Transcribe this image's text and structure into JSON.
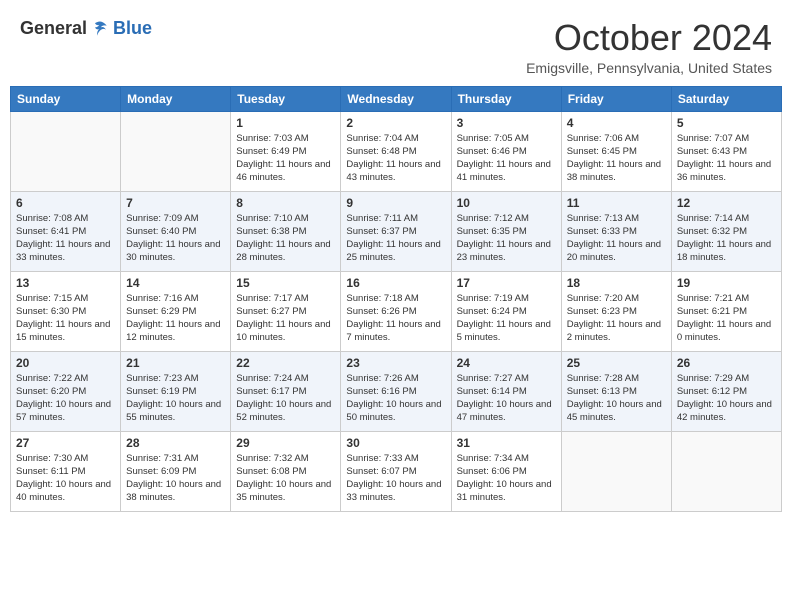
{
  "header": {
    "logo_general": "General",
    "logo_blue": "Blue",
    "month_title": "October 2024",
    "location": "Emigsville, Pennsylvania, United States"
  },
  "days_of_week": [
    "Sunday",
    "Monday",
    "Tuesday",
    "Wednesday",
    "Thursday",
    "Friday",
    "Saturday"
  ],
  "weeks": [
    [
      {
        "day": "",
        "sunrise": "",
        "sunset": "",
        "daylight": ""
      },
      {
        "day": "",
        "sunrise": "",
        "sunset": "",
        "daylight": ""
      },
      {
        "day": "1",
        "sunrise": "Sunrise: 7:03 AM",
        "sunset": "Sunset: 6:49 PM",
        "daylight": "Daylight: 11 hours and 46 minutes."
      },
      {
        "day": "2",
        "sunrise": "Sunrise: 7:04 AM",
        "sunset": "Sunset: 6:48 PM",
        "daylight": "Daylight: 11 hours and 43 minutes."
      },
      {
        "day": "3",
        "sunrise": "Sunrise: 7:05 AM",
        "sunset": "Sunset: 6:46 PM",
        "daylight": "Daylight: 11 hours and 41 minutes."
      },
      {
        "day": "4",
        "sunrise": "Sunrise: 7:06 AM",
        "sunset": "Sunset: 6:45 PM",
        "daylight": "Daylight: 11 hours and 38 minutes."
      },
      {
        "day": "5",
        "sunrise": "Sunrise: 7:07 AM",
        "sunset": "Sunset: 6:43 PM",
        "daylight": "Daylight: 11 hours and 36 minutes."
      }
    ],
    [
      {
        "day": "6",
        "sunrise": "Sunrise: 7:08 AM",
        "sunset": "Sunset: 6:41 PM",
        "daylight": "Daylight: 11 hours and 33 minutes."
      },
      {
        "day": "7",
        "sunrise": "Sunrise: 7:09 AM",
        "sunset": "Sunset: 6:40 PM",
        "daylight": "Daylight: 11 hours and 30 minutes."
      },
      {
        "day": "8",
        "sunrise": "Sunrise: 7:10 AM",
        "sunset": "Sunset: 6:38 PM",
        "daylight": "Daylight: 11 hours and 28 minutes."
      },
      {
        "day": "9",
        "sunrise": "Sunrise: 7:11 AM",
        "sunset": "Sunset: 6:37 PM",
        "daylight": "Daylight: 11 hours and 25 minutes."
      },
      {
        "day": "10",
        "sunrise": "Sunrise: 7:12 AM",
        "sunset": "Sunset: 6:35 PM",
        "daylight": "Daylight: 11 hours and 23 minutes."
      },
      {
        "day": "11",
        "sunrise": "Sunrise: 7:13 AM",
        "sunset": "Sunset: 6:33 PM",
        "daylight": "Daylight: 11 hours and 20 minutes."
      },
      {
        "day": "12",
        "sunrise": "Sunrise: 7:14 AM",
        "sunset": "Sunset: 6:32 PM",
        "daylight": "Daylight: 11 hours and 18 minutes."
      }
    ],
    [
      {
        "day": "13",
        "sunrise": "Sunrise: 7:15 AM",
        "sunset": "Sunset: 6:30 PM",
        "daylight": "Daylight: 11 hours and 15 minutes."
      },
      {
        "day": "14",
        "sunrise": "Sunrise: 7:16 AM",
        "sunset": "Sunset: 6:29 PM",
        "daylight": "Daylight: 11 hours and 12 minutes."
      },
      {
        "day": "15",
        "sunrise": "Sunrise: 7:17 AM",
        "sunset": "Sunset: 6:27 PM",
        "daylight": "Daylight: 11 hours and 10 minutes."
      },
      {
        "day": "16",
        "sunrise": "Sunrise: 7:18 AM",
        "sunset": "Sunset: 6:26 PM",
        "daylight": "Daylight: 11 hours and 7 minutes."
      },
      {
        "day": "17",
        "sunrise": "Sunrise: 7:19 AM",
        "sunset": "Sunset: 6:24 PM",
        "daylight": "Daylight: 11 hours and 5 minutes."
      },
      {
        "day": "18",
        "sunrise": "Sunrise: 7:20 AM",
        "sunset": "Sunset: 6:23 PM",
        "daylight": "Daylight: 11 hours and 2 minutes."
      },
      {
        "day": "19",
        "sunrise": "Sunrise: 7:21 AM",
        "sunset": "Sunset: 6:21 PM",
        "daylight": "Daylight: 11 hours and 0 minutes."
      }
    ],
    [
      {
        "day": "20",
        "sunrise": "Sunrise: 7:22 AM",
        "sunset": "Sunset: 6:20 PM",
        "daylight": "Daylight: 10 hours and 57 minutes."
      },
      {
        "day": "21",
        "sunrise": "Sunrise: 7:23 AM",
        "sunset": "Sunset: 6:19 PM",
        "daylight": "Daylight: 10 hours and 55 minutes."
      },
      {
        "day": "22",
        "sunrise": "Sunrise: 7:24 AM",
        "sunset": "Sunset: 6:17 PM",
        "daylight": "Daylight: 10 hours and 52 minutes."
      },
      {
        "day": "23",
        "sunrise": "Sunrise: 7:26 AM",
        "sunset": "Sunset: 6:16 PM",
        "daylight": "Daylight: 10 hours and 50 minutes."
      },
      {
        "day": "24",
        "sunrise": "Sunrise: 7:27 AM",
        "sunset": "Sunset: 6:14 PM",
        "daylight": "Daylight: 10 hours and 47 minutes."
      },
      {
        "day": "25",
        "sunrise": "Sunrise: 7:28 AM",
        "sunset": "Sunset: 6:13 PM",
        "daylight": "Daylight: 10 hours and 45 minutes."
      },
      {
        "day": "26",
        "sunrise": "Sunrise: 7:29 AM",
        "sunset": "Sunset: 6:12 PM",
        "daylight": "Daylight: 10 hours and 42 minutes."
      }
    ],
    [
      {
        "day": "27",
        "sunrise": "Sunrise: 7:30 AM",
        "sunset": "Sunset: 6:11 PM",
        "daylight": "Daylight: 10 hours and 40 minutes."
      },
      {
        "day": "28",
        "sunrise": "Sunrise: 7:31 AM",
        "sunset": "Sunset: 6:09 PM",
        "daylight": "Daylight: 10 hours and 38 minutes."
      },
      {
        "day": "29",
        "sunrise": "Sunrise: 7:32 AM",
        "sunset": "Sunset: 6:08 PM",
        "daylight": "Daylight: 10 hours and 35 minutes."
      },
      {
        "day": "30",
        "sunrise": "Sunrise: 7:33 AM",
        "sunset": "Sunset: 6:07 PM",
        "daylight": "Daylight: 10 hours and 33 minutes."
      },
      {
        "day": "31",
        "sunrise": "Sunrise: 7:34 AM",
        "sunset": "Sunset: 6:06 PM",
        "daylight": "Daylight: 10 hours and 31 minutes."
      },
      {
        "day": "",
        "sunrise": "",
        "sunset": "",
        "daylight": ""
      },
      {
        "day": "",
        "sunrise": "",
        "sunset": "",
        "daylight": ""
      }
    ]
  ]
}
